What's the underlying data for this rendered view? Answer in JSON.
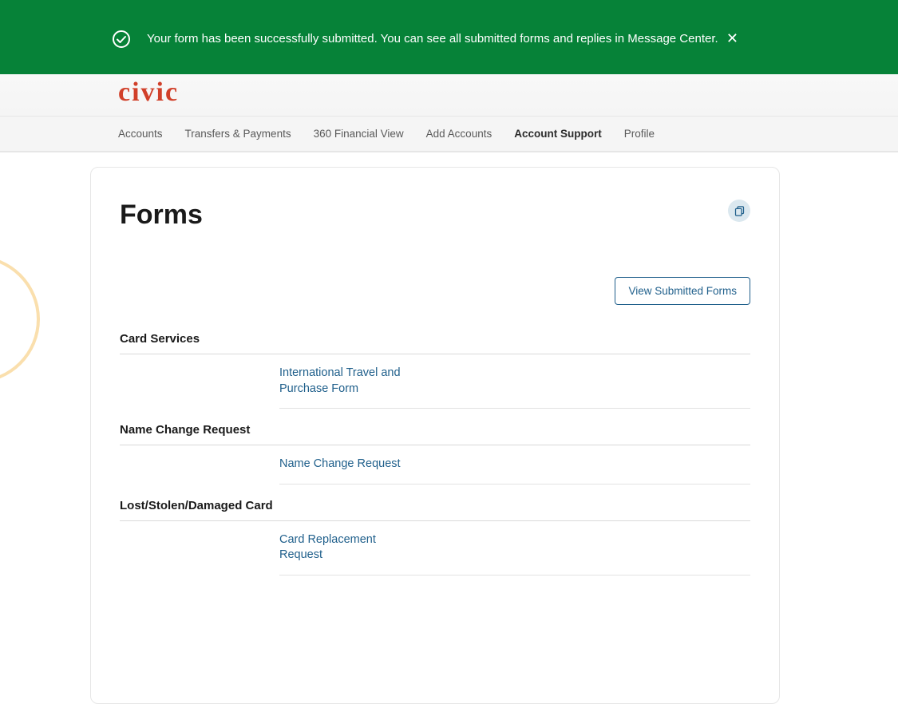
{
  "banner": {
    "message": "Your form has been successfully submitted. You can see all submitted forms and replies in Message Center.",
    "close_label": "✕"
  },
  "brand": {
    "logo_text": "civic"
  },
  "nav": {
    "items": [
      {
        "label": "Accounts",
        "active": false
      },
      {
        "label": "Transfers & Payments",
        "active": false
      },
      {
        "label": "360 Financial View",
        "active": false
      },
      {
        "label": "Add Accounts",
        "active": false
      },
      {
        "label": "Account Support",
        "active": true
      },
      {
        "label": "Profile",
        "active": false
      }
    ]
  },
  "page": {
    "title": "Forms",
    "view_submitted_label": "View Submitted Forms"
  },
  "sections": [
    {
      "title": "Card Services",
      "forms": [
        {
          "label": "International Travel and Purchase Form"
        }
      ]
    },
    {
      "title": "Name Change Request",
      "forms": [
        {
          "label": "Name Change Request"
        }
      ]
    },
    {
      "title": "Lost/Stolen/Damaged Card",
      "forms": [
        {
          "label": "Card Replacement Request"
        }
      ]
    }
  ]
}
